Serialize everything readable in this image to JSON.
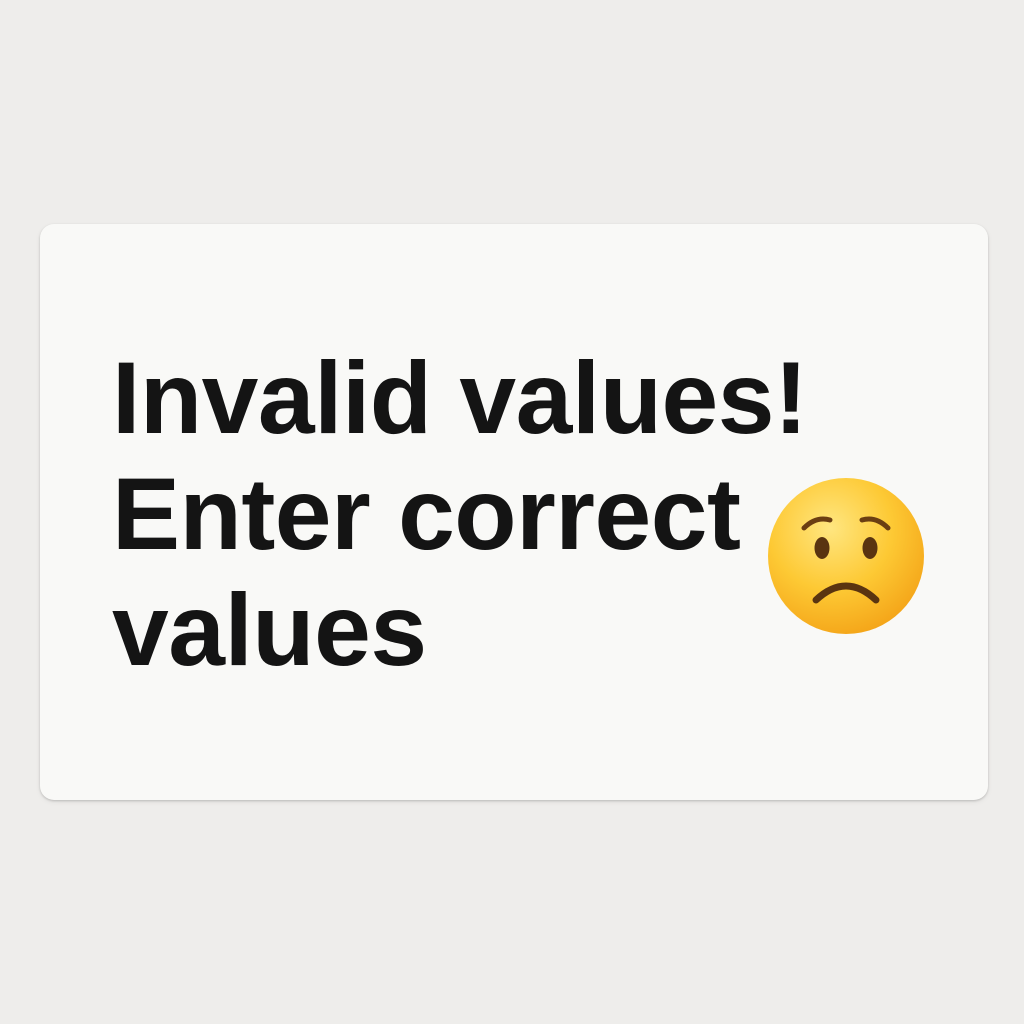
{
  "dialog": {
    "line1": "Invalid values!",
    "line2": "Enter correct",
    "line3": "values",
    "icon": "sad-face-emoji"
  },
  "colors": {
    "background": "#eeedeb",
    "card": "#f9f9f7",
    "text": "#141414",
    "emoji_face": "#fbc02d"
  }
}
